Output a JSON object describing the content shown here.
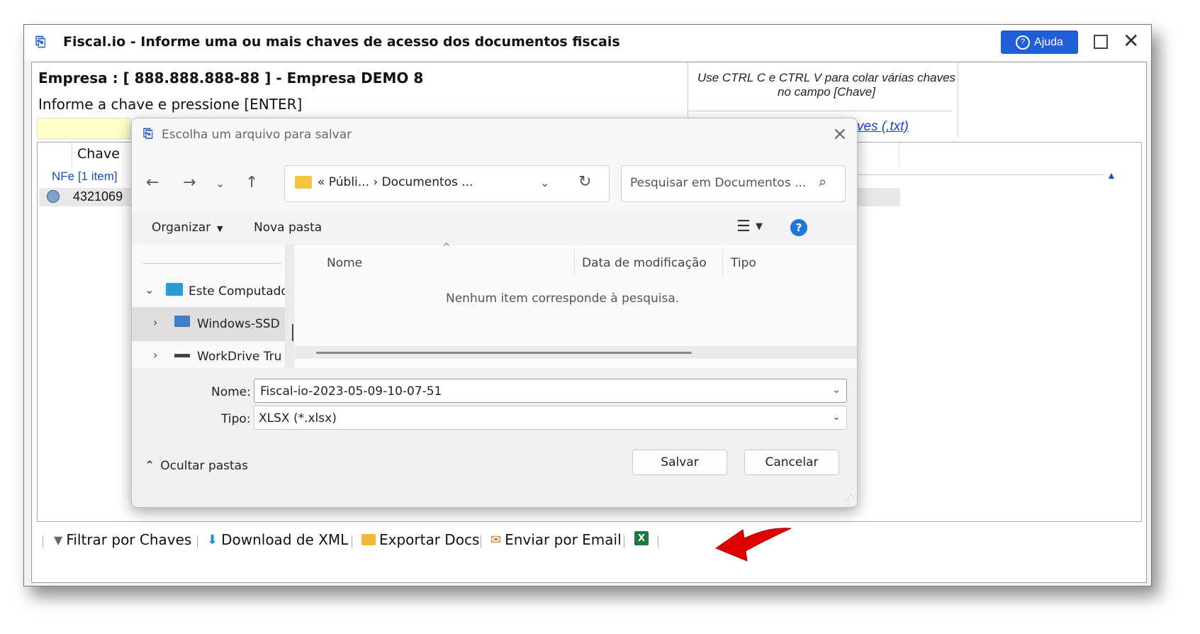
{
  "window": {
    "title": "Fiscal.io - Informe uma ou mais chaves de acesso dos documentos fiscais",
    "help_label": "Ajuda"
  },
  "header": {
    "company": "Empresa : [ 888.888.888-88 ] - Empresa DEMO 8",
    "instruction": "Informe a chave e pressione [ENTER]",
    "tip": "Use CTRL C e CTRL V para colar várias chaves no campo [Chave]",
    "txt_link": "ves (.txt)"
  },
  "grid": {
    "column_header": "Chave",
    "group_label": "NFe [1 item]",
    "row_key": "4321069"
  },
  "toolbar": {
    "filter_label": "Filtrar por Chaves",
    "download_label": "Download de XML",
    "export_label": "Exportar Docs",
    "email_label": "Enviar por Email"
  },
  "dialog": {
    "title": "Escolha um arquivo para salvar",
    "breadcrumbs": "« Públi...  ›  Documentos ...",
    "search_placeholder": "Pesquisar em Documentos ...",
    "organize_label": "Organizar",
    "new_folder_label": "Nova pasta",
    "tree": [
      {
        "label": "Este Computador"
      },
      {
        "label": "Windows-SSD"
      },
      {
        "label": "WorkDrive Tru"
      }
    ],
    "columns": {
      "name": "Nome",
      "date": "Data de modificação",
      "type": "Tipo"
    },
    "empty_message": "Nenhum item corresponde à pesquisa.",
    "name_label": "Nome:",
    "name_value": "Fiscal-io-2023-05-09-10-07-51",
    "type_label": "Tipo:",
    "type_value": "XLSX (*.xlsx)",
    "hide_folders_label": "Ocultar pastas",
    "save_label": "Salvar",
    "cancel_label": "Cancelar"
  },
  "colors": {
    "accent": "#1f5ed6",
    "input_yellow": "#ffffc8",
    "arrow_red": "#e00000",
    "excel_green": "#1d7a3d"
  }
}
